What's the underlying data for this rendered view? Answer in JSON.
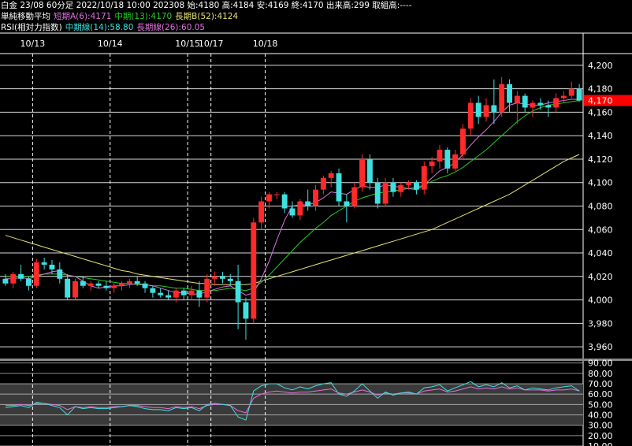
{
  "header": {
    "line1": "白金 23/08 60分足 2022/10/18 10:00 202308 始:4180 高:4184 安:4169 終:4170 出来高:299 取組高:----",
    "line2_label": "単純移動平均",
    "ma_short": "短期A(6):4171",
    "ma_mid": "中期(13):4170",
    "ma_long": "長期B(52):4124",
    "line3_label": "RSI(相対力指数)",
    "rsi_mid": "中期線(14):58.80",
    "rsi_long": "長期線(26):60.05"
  },
  "colors": {
    "up": "#ff2a2a",
    "down": "#40e0e0",
    "ma_short": "#e070e0",
    "ma_mid": "#22cc22",
    "ma_long": "#e6e070",
    "rsi_mid": "#40e0e0",
    "rsi_long": "#e070e0",
    "price_tag": "#ff0000"
  },
  "chart_data": {
    "type": "candlestick",
    "title": "白金 23/08 60分足",
    "date_labels": [
      {
        "label": "10/13",
        "index": 4
      },
      {
        "label": "10/14",
        "index": 14
      },
      {
        "label": "10/15",
        "index": 24
      },
      {
        "label": "10/17",
        "index": 27
      },
      {
        "label": "10/18",
        "index": 34
      }
    ],
    "date_separators": [
      4,
      14,
      24,
      27,
      34
    ],
    "price_axis": {
      "min": 3950,
      "max": 4210,
      "ticks": [
        3960,
        3980,
        4000,
        4020,
        4040,
        4060,
        4080,
        4100,
        4120,
        4140,
        4160,
        4180,
        4200
      ]
    },
    "last_price": "4,170",
    "last_price_value": 4170,
    "candles": [
      {
        "o": 4018,
        "h": 4022,
        "l": 4012,
        "c": 4014
      },
      {
        "o": 4014,
        "h": 4024,
        "l": 4010,
        "c": 4022
      },
      {
        "o": 4022,
        "h": 4030,
        "l": 4016,
        "c": 4018
      },
      {
        "o": 4018,
        "h": 4020,
        "l": 4008,
        "c": 4012
      },
      {
        "o": 4012,
        "h": 4035,
        "l": 4010,
        "c": 4032
      },
      {
        "o": 4032,
        "h": 4036,
        "l": 4026,
        "c": 4030
      },
      {
        "o": 4030,
        "h": 4034,
        "l": 4022,
        "c": 4026
      },
      {
        "o": 4026,
        "h": 4032,
        "l": 4014,
        "c": 4018
      },
      {
        "o": 4018,
        "h": 4022,
        "l": 4000,
        "c": 4002
      },
      {
        "o": 4002,
        "h": 4018,
        "l": 4000,
        "c": 4016
      },
      {
        "o": 4016,
        "h": 4020,
        "l": 4010,
        "c": 4012
      },
      {
        "o": 4012,
        "h": 4016,
        "l": 4008,
        "c": 4014
      },
      {
        "o": 4014,
        "h": 4016,
        "l": 4010,
        "c": 4012
      },
      {
        "o": 4012,
        "h": 4016,
        "l": 4008,
        "c": 4010
      },
      {
        "o": 4010,
        "h": 4014,
        "l": 4006,
        "c": 4012
      },
      {
        "o": 4012,
        "h": 4016,
        "l": 4008,
        "c": 4014
      },
      {
        "o": 4014,
        "h": 4018,
        "l": 4010,
        "c": 4016
      },
      {
        "o": 4016,
        "h": 4020,
        "l": 4012,
        "c": 4014
      },
      {
        "o": 4014,
        "h": 4016,
        "l": 4006,
        "c": 4010
      },
      {
        "o": 4010,
        "h": 4012,
        "l": 4002,
        "c": 4006
      },
      {
        "o": 4006,
        "h": 4010,
        "l": 4002,
        "c": 4004
      },
      {
        "o": 4004,
        "h": 4008,
        "l": 4000,
        "c": 4002
      },
      {
        "o": 4002,
        "h": 4010,
        "l": 3998,
        "c": 4008
      },
      {
        "o": 4008,
        "h": 4010,
        "l": 4000,
        "c": 4004
      },
      {
        "o": 4004,
        "h": 4012,
        "l": 4000,
        "c": 4008
      },
      {
        "o": 4008,
        "h": 4016,
        "l": 3994,
        "c": 4002
      },
      {
        "o": 4002,
        "h": 4022,
        "l": 3998,
        "c": 4018
      },
      {
        "o": 4018,
        "h": 4024,
        "l": 4012,
        "c": 4020
      },
      {
        "o": 4020,
        "h": 4024,
        "l": 4014,
        "c": 4018
      },
      {
        "o": 4018,
        "h": 4022,
        "l": 4012,
        "c": 4016
      },
      {
        "o": 4016,
        "h": 4030,
        "l": 3975,
        "c": 3998
      },
      {
        "o": 3998,
        "h": 4002,
        "l": 3966,
        "c": 3984
      },
      {
        "o": 3984,
        "h": 4070,
        "l": 3980,
        "c": 4066
      },
      {
        "o": 4066,
        "h": 4088,
        "l": 4060,
        "c": 4084
      },
      {
        "o": 4084,
        "h": 4092,
        "l": 4078,
        "c": 4090
      },
      {
        "o": 4090,
        "h": 4092,
        "l": 4086,
        "c": 4090
      },
      {
        "o": 4090,
        "h": 4092,
        "l": 4074,
        "c": 4078
      },
      {
        "o": 4078,
        "h": 4084,
        "l": 4070,
        "c": 4072
      },
      {
        "o": 4072,
        "h": 4086,
        "l": 4068,
        "c": 4084
      },
      {
        "o": 4084,
        "h": 4094,
        "l": 4076,
        "c": 4080
      },
      {
        "o": 4080,
        "h": 4098,
        "l": 4076,
        "c": 4094
      },
      {
        "o": 4094,
        "h": 4106,
        "l": 4090,
        "c": 4104
      },
      {
        "o": 4104,
        "h": 4110,
        "l": 4096,
        "c": 4108
      },
      {
        "o": 4108,
        "h": 4112,
        "l": 4080,
        "c": 4084
      },
      {
        "o": 4084,
        "h": 4090,
        "l": 4066,
        "c": 4080
      },
      {
        "o": 4080,
        "h": 4100,
        "l": 4078,
        "c": 4096
      },
      {
        "o": 4096,
        "h": 4124,
        "l": 4092,
        "c": 4120
      },
      {
        "o": 4120,
        "h": 4124,
        "l": 4094,
        "c": 4100
      },
      {
        "o": 4100,
        "h": 4104,
        "l": 4078,
        "c": 4082
      },
      {
        "o": 4082,
        "h": 4104,
        "l": 4080,
        "c": 4100
      },
      {
        "o": 4100,
        "h": 4104,
        "l": 4088,
        "c": 4092
      },
      {
        "o": 4092,
        "h": 4100,
        "l": 4088,
        "c": 4098
      },
      {
        "o": 4098,
        "h": 4102,
        "l": 4094,
        "c": 4100
      },
      {
        "o": 4100,
        "h": 4102,
        "l": 4090,
        "c": 4094
      },
      {
        "o": 4094,
        "h": 4118,
        "l": 4090,
        "c": 4114
      },
      {
        "o": 4114,
        "h": 4122,
        "l": 4108,
        "c": 4118
      },
      {
        "o": 4118,
        "h": 4132,
        "l": 4112,
        "c": 4128
      },
      {
        "o": 4128,
        "h": 4130,
        "l": 4108,
        "c": 4112
      },
      {
        "o": 4112,
        "h": 4128,
        "l": 4110,
        "c": 4124
      },
      {
        "o": 4124,
        "h": 4150,
        "l": 4120,
        "c": 4146
      },
      {
        "o": 4146,
        "h": 4172,
        "l": 4140,
        "c": 4168
      },
      {
        "o": 4168,
        "h": 4174,
        "l": 4150,
        "c": 4156
      },
      {
        "o": 4156,
        "h": 4172,
        "l": 4152,
        "c": 4166
      },
      {
        "o": 4166,
        "h": 4188,
        "l": 4150,
        "c": 4160
      },
      {
        "o": 4160,
        "h": 4190,
        "l": 4156,
        "c": 4184
      },
      {
        "o": 4184,
        "h": 4188,
        "l": 4160,
        "c": 4168
      },
      {
        "o": 4168,
        "h": 4178,
        "l": 4150,
        "c": 4174
      },
      {
        "o": 4174,
        "h": 4176,
        "l": 4160,
        "c": 4164
      },
      {
        "o": 4164,
        "h": 4170,
        "l": 4156,
        "c": 4168
      },
      {
        "o": 4168,
        "h": 4172,
        "l": 4162,
        "c": 4166
      },
      {
        "o": 4166,
        "h": 4170,
        "l": 4156,
        "c": 4164
      },
      {
        "o": 4164,
        "h": 4176,
        "l": 4160,
        "c": 4172
      },
      {
        "o": 4172,
        "h": 4178,
        "l": 4168,
        "c": 4174
      },
      {
        "o": 4174,
        "h": 4186,
        "l": 4172,
        "c": 4180
      },
      {
        "o": 4180,
        "h": 4184,
        "l": 4169,
        "c": 4170
      }
    ],
    "ma_short": [
      4018,
      4018,
      4019,
      4018,
      4020,
      4022,
      4024,
      4025,
      4021,
      4020,
      4016,
      4012,
      4010,
      4011,
      4012,
      4012,
      4013,
      4014,
      4013,
      4012,
      4010,
      4008,
      4006,
      4006,
      4005,
      4005,
      4007,
      4009,
      4011,
      4012,
      4008,
      4004,
      4006,
      4018,
      4033,
      4051,
      4068,
      4080,
      4081,
      4081,
      4083,
      4087,
      4092,
      4091,
      4090,
      4094,
      4097,
      4096,
      4096,
      4098,
      4097,
      4096,
      4095,
      4094,
      4098,
      4104,
      4110,
      4113,
      4117,
      4124,
      4132,
      4139,
      4145,
      4152,
      4160,
      4166,
      4168,
      4167,
      4166,
      4166,
      4168,
      4169,
      4170,
      4171,
      4171
    ],
    "ma_mid": [
      4020,
      4020,
      4020,
      4020,
      4021,
      4022,
      4022,
      4022,
      4021,
      4020,
      4019,
      4018,
      4017,
      4016,
      4015,
      4014,
      4014,
      4013,
      4013,
      4012,
      4012,
      4011,
      4010,
      4010,
      4009,
      4008,
      4008,
      4008,
      4009,
      4010,
      4009,
      4008,
      4010,
      4015,
      4021,
      4028,
      4035,
      4042,
      4049,
      4055,
      4061,
      4066,
      4072,
      4076,
      4080,
      4084,
      4087,
      4089,
      4091,
      4092,
      4093,
      4094,
      4095,
      4096,
      4098,
      4101,
      4104,
      4106,
      4109,
      4113,
      4118,
      4123,
      4128,
      4134,
      4140,
      4146,
      4152,
      4157,
      4161,
      4164,
      4166,
      4167,
      4168,
      4169,
      4170
    ],
    "ma_long": [
      4055,
      4053,
      4051,
      4049,
      4047,
      4045,
      4043,
      4041,
      4039,
      4037,
      4035,
      4033,
      4031,
      4029,
      4027,
      4025,
      4024,
      4022,
      4021,
      4020,
      4019,
      4018,
      4017,
      4016,
      4015,
      4014,
      4014,
      4013,
      4013,
      4013,
      4013,
      4013,
      4014,
      4016,
      4018,
      4020,
      4022,
      4024,
      4026,
      4028,
      4030,
      4032,
      4034,
      4036,
      4038,
      4040,
      4042,
      4044,
      4046,
      4048,
      4050,
      4052,
      4054,
      4056,
      4058,
      4060,
      4063,
      4066,
      4069,
      4072,
      4075,
      4078,
      4081,
      4084,
      4087,
      4090,
      4094,
      4098,
      4102,
      4106,
      4110,
      4114,
      4118,
      4121,
      4124
    ],
    "rsi_axis": {
      "min": 10,
      "max": 90,
      "ticks": [
        10,
        20,
        30,
        40,
        50,
        60,
        70,
        80,
        90
      ],
      "tick_labels": [
        "10.00",
        "20.00",
        "30.00",
        "40.00",
        "50.00",
        "60.00",
        "70.00",
        "80.00",
        "90.00"
      ],
      "band": [
        30,
        70
      ]
    },
    "rsi_mid": [
      47,
      48,
      49,
      47,
      52,
      51,
      49,
      47,
      40,
      48,
      46,
      47,
      46,
      46,
      47,
      48,
      49,
      48,
      46,
      45,
      45,
      44,
      47,
      46,
      47,
      44,
      50,
      51,
      50,
      49,
      38,
      35,
      63,
      68,
      70,
      70,
      66,
      64,
      67,
      65,
      68,
      70,
      71,
      60,
      58,
      63,
      70,
      63,
      56,
      62,
      59,
      61,
      62,
      60,
      66,
      67,
      69,
      63,
      66,
      69,
      72,
      67,
      69,
      67,
      71,
      66,
      68,
      64,
      66,
      65,
      64,
      66,
      67,
      68,
      63
    ],
    "rsi_long": [
      49,
      49,
      50,
      49,
      51,
      51,
      50,
      49,
      45,
      48,
      47,
      48,
      47,
      47,
      48,
      48,
      49,
      49,
      48,
      47,
      47,
      46,
      48,
      47,
      48,
      46,
      49,
      50,
      50,
      49,
      44,
      42,
      56,
      60,
      62,
      63,
      62,
      61,
      62,
      62,
      63,
      64,
      65,
      61,
      60,
      62,
      64,
      62,
      59,
      61,
      60,
      61,
      61,
      60,
      63,
      64,
      65,
      62,
      63,
      65,
      67,
      65,
      66,
      65,
      67,
      65,
      66,
      64,
      64,
      64,
      63,
      64,
      64,
      65,
      63
    ]
  }
}
